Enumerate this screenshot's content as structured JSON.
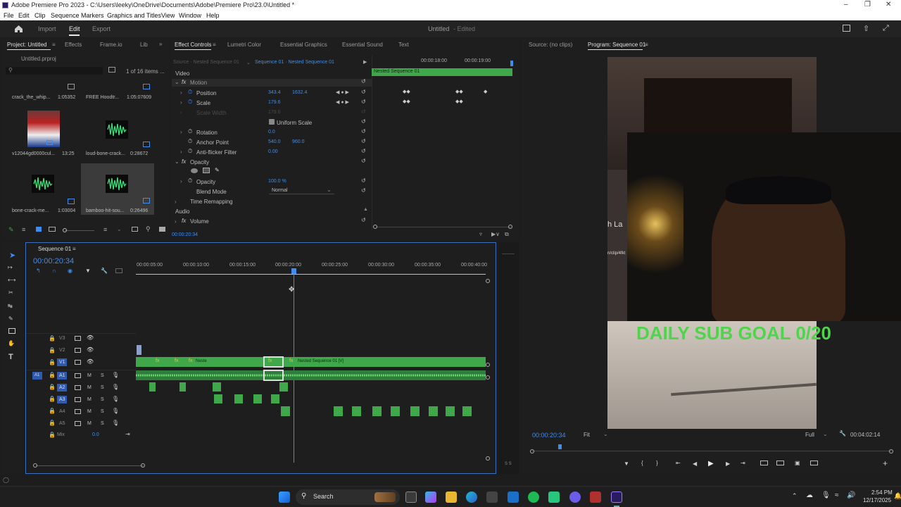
{
  "window": {
    "title": "Adobe Premiere Pro 2023 - C:\\Users\\leeky\\OneDrive\\Documents\\Adobe\\Premiere Pro\\23.0\\Untitled *"
  },
  "menu": [
    "File",
    "Edit",
    "Clip",
    "Sequence",
    "Markers",
    "Graphics and Titles",
    "View",
    "Window",
    "Help"
  ],
  "header": {
    "tabs": [
      "Import",
      "Edit",
      "Export"
    ],
    "active": "Edit",
    "project_name": "Untitled",
    "project_status": "- Edited"
  },
  "project_panel": {
    "tabs": [
      "Project: Untitled",
      "Effects",
      "Frame.io",
      "Lib"
    ],
    "file": "Untitled.prproj",
    "item_count": "1 of 16 items ...",
    "items": [
      {
        "name": "crack_the_whip...",
        "duration": "1:05352"
      },
      {
        "name": "FREE Hoodtr...",
        "duration": "1:05:07609"
      },
      {
        "name": "v12044gd0000cul...",
        "duration": "13:25"
      },
      {
        "name": "loud-bone-crack...",
        "duration": "0:28672"
      },
      {
        "name": "bone-crack-me...",
        "duration": "1:03004"
      },
      {
        "name": "bamboo-hit-sou...",
        "duration": "0:26496"
      }
    ]
  },
  "effect_controls": {
    "tabs": [
      "Effect Controls",
      "Lumetri Color",
      "Essential Graphics",
      "Essential Sound",
      "Text"
    ],
    "source": "Source · Nested Sequence 01",
    "sequence": "Sequence 01 · Nested Sequence 01",
    "section_video": "Video",
    "motion": "Motion",
    "properties": [
      {
        "name": "Position",
        "v1": "343.4",
        "v2": "1632.4"
      },
      {
        "name": "Scale",
        "v1": "179.6",
        "v2": ""
      },
      {
        "name": "Scale Width",
        "v1": "179.6",
        "v2": ""
      },
      {
        "name": "Rotation",
        "v1": "0.0",
        "v2": ""
      },
      {
        "name": "Anchor Point",
        "v1": "540.0",
        "v2": "960.0"
      },
      {
        "name": "Anti-flicker Filter",
        "v1": "0.00",
        "v2": ""
      }
    ],
    "uniform_scale": "Uniform Scale",
    "opacity_group": "Opacity",
    "opacity": {
      "name": "Opacity",
      "value": "100.0 %"
    },
    "blend_mode": {
      "name": "Blend Mode",
      "value": "Normal"
    },
    "time_remapping": "Time Remapping",
    "section_audio": "Audio",
    "volume": "Volume",
    "timecode": "00:00:20:34",
    "ruler": [
      "00:00:18:00",
      "00:00:19:00"
    ],
    "clip": "Nested Sequence 01"
  },
  "source_monitor": {
    "tab": "Source: (no clips)"
  },
  "program_monitor": {
    "tab": "Program: Sequence 01",
    "overlay_text": "DAILY SUB GOAL 0/20",
    "side_text": "h La",
    "side_url": "n/clip/4fkt",
    "timecode": "00:00:20:34",
    "fit": "Fit",
    "quality": "Full",
    "duration": "00:04:02:14"
  },
  "timeline": {
    "tab": "Sequence 01",
    "timecode": "00:00:20:34",
    "ruler": [
      "00:00:05:00",
      "00:00:10:00",
      "00:00:15:00",
      "00:00:20:00",
      "00:00:25:00",
      "00:00:30:00",
      "00:00:35:00",
      "00:00:40:00"
    ],
    "video_tracks": [
      "V3",
      "V2",
      "V1"
    ],
    "audio_tracks": [
      "A1",
      "A2",
      "A3",
      "A4",
      "A5"
    ],
    "mix": {
      "label": "Mix",
      "value": "0.0"
    },
    "clip_short": "Neste",
    "clip_long": "Nested Sequence 01 [V]",
    "fx": "fx",
    "m": "M",
    "s": "S",
    "footer_s": "S S"
  },
  "taskbar": {
    "search": "Search",
    "time": "2:54 PM",
    "date": "12/17/2025"
  },
  "colors": {
    "accent_blue": "#3d8ef0",
    "clip_green": "#3ea84a",
    "overlay_green": "#4fd44b"
  }
}
